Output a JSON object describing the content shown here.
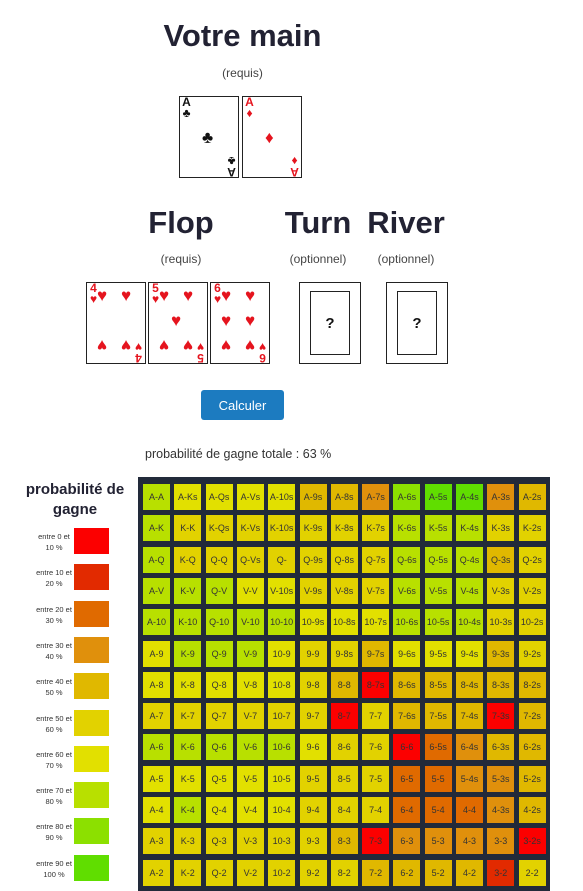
{
  "hand": {
    "title": "Votre main",
    "note": "(requis)",
    "cards": [
      {
        "rank": "A",
        "suit": "♣",
        "color": "#111111",
        "name": "ace-of-clubs-card"
      },
      {
        "rank": "A",
        "suit": "♦",
        "color": "#e5141e",
        "name": "ace-of-diamonds-card"
      }
    ]
  },
  "flop": {
    "title": "Flop",
    "note": "(requis)",
    "cards": [
      {
        "rank": "4",
        "suit": "♥",
        "color": "#e5141e",
        "name": "four-of-hearts-card"
      },
      {
        "rank": "5",
        "suit": "♥",
        "color": "#e5141e",
        "name": "five-of-hearts-card"
      },
      {
        "rank": "6",
        "suit": "♥",
        "color": "#e5141e",
        "name": "six-of-hearts-card"
      }
    ]
  },
  "turn": {
    "title": "Turn",
    "note": "(optionnel)",
    "placeholder": "?"
  },
  "river": {
    "title": "River",
    "note": "(optionnel)",
    "placeholder": "?"
  },
  "calculate_button": "Calculer",
  "total_probability": "probabilité de gagne totale : 63 %",
  "legend": {
    "title": "probabilité de gagne",
    "items": [
      {
        "label": "entre 0 et 10 %",
        "color": "#fc0000"
      },
      {
        "label": "entre 10 et 20 %",
        "color": "#e22a00"
      },
      {
        "label": "entre 20 et 30 %",
        "color": "#e06a00"
      },
      {
        "label": "entre 30 et 40 %",
        "color": "#e0900c"
      },
      {
        "label": "entre 40 et 50 %",
        "color": "#e0b800"
      },
      {
        "label": "entre 50 et 60 %",
        "color": "#e2d200"
      },
      {
        "label": "entre 60 et 70 %",
        "color": "#e2e000"
      },
      {
        "label": "entre 70 et 80 %",
        "color": "#b8e000"
      },
      {
        "label": "entre 80 et 90 %",
        "color": "#8ce000"
      },
      {
        "label": "entre 90 et 100 %",
        "color": "#60de00"
      }
    ]
  },
  "matrix": {
    "rows": [
      [
        [
          "A-A",
          7
        ],
        [
          "A-Ks",
          6
        ],
        [
          "A-Qs",
          6
        ],
        [
          "A-Vs",
          6
        ],
        [
          "A-10s",
          6
        ],
        [
          "A-9s",
          4
        ],
        [
          "A-8s",
          4
        ],
        [
          "A-7s",
          3
        ],
        [
          "A-6s",
          8
        ],
        [
          "A-5s",
          9
        ],
        [
          "A-4s",
          9
        ],
        [
          "A-3s",
          3
        ],
        [
          "A-2s",
          4
        ]
      ],
      [
        [
          "A-K",
          7
        ],
        [
          "K-K",
          5
        ],
        [
          "K-Qs",
          5
        ],
        [
          "K-Vs",
          5
        ],
        [
          "K-10s",
          5
        ],
        [
          "K-9s",
          5
        ],
        [
          "K-8s",
          5
        ],
        [
          "K-7s",
          5
        ],
        [
          "K-6s",
          7
        ],
        [
          "K-5s",
          7
        ],
        [
          "K-4s",
          7
        ],
        [
          "K-3s",
          5
        ],
        [
          "K-2s",
          5
        ]
      ],
      [
        [
          "A-Q",
          7
        ],
        [
          "K-Q",
          5
        ],
        [
          "Q-Q",
          5
        ],
        [
          "Q-Vs",
          5
        ],
        [
          "Q-",
          5
        ],
        [
          "Q-9s",
          5
        ],
        [
          "Q-8s",
          5
        ],
        [
          "Q-7s",
          5
        ],
        [
          "Q-6s",
          7
        ],
        [
          "Q-5s",
          7
        ],
        [
          "Q-4s",
          7
        ],
        [
          "Q-3s",
          4
        ],
        [
          "Q-2s",
          5
        ]
      ],
      [
        [
          "A-V",
          7
        ],
        [
          "K-V",
          7
        ],
        [
          "Q-V",
          7
        ],
        [
          "V-V",
          6
        ],
        [
          "V-10s",
          6
        ],
        [
          "V-9s",
          5
        ],
        [
          "V-8s",
          5
        ],
        [
          "V-7s",
          5
        ],
        [
          "V-6s",
          7
        ],
        [
          "V-5s",
          7
        ],
        [
          "V-4s",
          7
        ],
        [
          "V-3s",
          5
        ],
        [
          "V-2s",
          5
        ]
      ],
      [
        [
          "A-10",
          7
        ],
        [
          "K-10",
          7
        ],
        [
          "Q-10",
          7
        ],
        [
          "V-10",
          7
        ],
        [
          "10-10",
          7
        ],
        [
          "10-9s",
          6
        ],
        [
          "10-8s",
          6
        ],
        [
          "10-7s",
          6
        ],
        [
          "10-6s",
          7
        ],
        [
          "10-5s",
          7
        ],
        [
          "10-4s",
          7
        ],
        [
          "10-3s",
          5
        ],
        [
          "10-2s",
          5
        ]
      ],
      [
        [
          "A-9",
          6
        ],
        [
          "K-9",
          7
        ],
        [
          "Q-9",
          7
        ],
        [
          "V-9",
          7
        ],
        [
          "10-9",
          6
        ],
        [
          "9-9",
          5
        ],
        [
          "9-8s",
          5
        ],
        [
          "9-7s",
          4
        ],
        [
          "9-6s",
          6
        ],
        [
          "9-5s",
          6
        ],
        [
          "9-4s",
          6
        ],
        [
          "9-3s",
          4
        ],
        [
          "9-2s",
          5
        ]
      ],
      [
        [
          "A-8",
          6
        ],
        [
          "K-8",
          6
        ],
        [
          "Q-8",
          6
        ],
        [
          "V-8",
          6
        ],
        [
          "10-8",
          6
        ],
        [
          "9-8",
          5
        ],
        [
          "8-8",
          4
        ],
        [
          "8-7s",
          0
        ],
        [
          "8-6s",
          4
        ],
        [
          "8-5s",
          4
        ],
        [
          "8-4s",
          4
        ],
        [
          "8-3s",
          4
        ],
        [
          "8-2s",
          4
        ]
      ],
      [
        [
          "A-7",
          5
        ],
        [
          "K-7",
          5
        ],
        [
          "Q-7",
          5
        ],
        [
          "V-7",
          5
        ],
        [
          "10-7",
          5
        ],
        [
          "9-7",
          5
        ],
        [
          "8-7",
          0
        ],
        [
          "7-7",
          5
        ],
        [
          "7-6s",
          4
        ],
        [
          "7-5s",
          4
        ],
        [
          "7-4s",
          4
        ],
        [
          "7-3s",
          0
        ],
        [
          "7-2s",
          4
        ]
      ],
      [
        [
          "A-6",
          7
        ],
        [
          "K-6",
          7
        ],
        [
          "Q-6",
          7
        ],
        [
          "V-6",
          7
        ],
        [
          "10-6",
          7
        ],
        [
          "9-6",
          6
        ],
        [
          "8-6",
          5
        ],
        [
          "7-6",
          5
        ],
        [
          "6-6",
          0
        ],
        [
          "6-5s",
          2
        ],
        [
          "6-4s",
          3
        ],
        [
          "6-3s",
          4
        ],
        [
          "6-2s",
          4
        ]
      ],
      [
        [
          "A-5",
          6
        ],
        [
          "K-5",
          6
        ],
        [
          "Q-5",
          6
        ],
        [
          "V-5",
          6
        ],
        [
          "10-5",
          6
        ],
        [
          "9-5",
          5
        ],
        [
          "8-5",
          5
        ],
        [
          "7-5",
          5
        ],
        [
          "6-5",
          2
        ],
        [
          "5-5",
          2
        ],
        [
          "5-4s",
          3
        ],
        [
          "5-3s",
          3
        ],
        [
          "5-2s",
          4
        ]
      ],
      [
        [
          "A-4",
          6
        ],
        [
          "K-4",
          7
        ],
        [
          "Q-4",
          6
        ],
        [
          "V-4",
          6
        ],
        [
          "10-4",
          6
        ],
        [
          "9-4",
          5
        ],
        [
          "8-4",
          5
        ],
        [
          "7-4",
          5
        ],
        [
          "6-4",
          2
        ],
        [
          "5-4",
          2
        ],
        [
          "4-4",
          2
        ],
        [
          "4-3s",
          3
        ],
        [
          "4-2s",
          4
        ]
      ],
      [
        [
          "A-3",
          5
        ],
        [
          "K-3",
          5
        ],
        [
          "Q-3",
          5
        ],
        [
          "V-3",
          5
        ],
        [
          "10-3",
          5
        ],
        [
          "9-3",
          5
        ],
        [
          "8-3",
          4
        ],
        [
          "7-3",
          0
        ],
        [
          "6-3",
          3
        ],
        [
          "5-3",
          3
        ],
        [
          "4-3",
          3
        ],
        [
          "3-3",
          3
        ],
        [
          "3-2s",
          0
        ]
      ],
      [
        [
          "A-2",
          5
        ],
        [
          "K-2",
          5
        ],
        [
          "Q-2",
          5
        ],
        [
          "V-2",
          5
        ],
        [
          "10-2",
          5
        ],
        [
          "9-2",
          5
        ],
        [
          "8-2",
          5
        ],
        [
          "7-2",
          4
        ],
        [
          "6-2",
          4
        ],
        [
          "5-2",
          4
        ],
        [
          "4-2",
          4
        ],
        [
          "3-2",
          1
        ],
        [
          "2-2",
          5
        ]
      ]
    ]
  }
}
